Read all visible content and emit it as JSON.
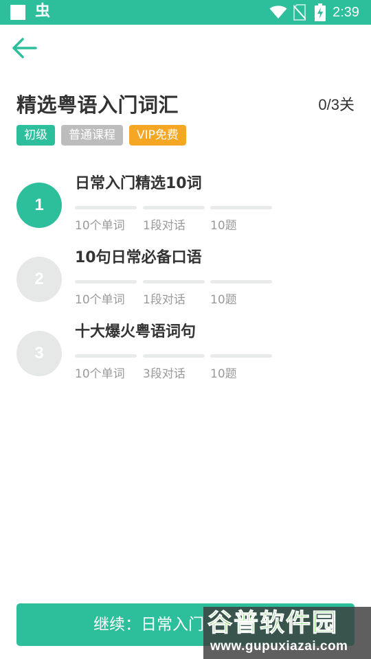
{
  "status_bar": {
    "app_icon": "虫",
    "time": "2:39",
    "icons": [
      "notification-square-icon",
      "wifi-icon",
      "no-sim-icon",
      "battery-charging-icon"
    ]
  },
  "back_icon": "arrow-left-icon",
  "course": {
    "title": "精选粤语入门词汇",
    "progress": "0/3关",
    "tags": {
      "level": "初级",
      "course_type": "普通课程",
      "vip": "VIP免费"
    }
  },
  "lessons": [
    {
      "number": "1",
      "title": "日常入门精选10词",
      "words": "10个单词",
      "dialogues": "1段对话",
      "questions": "10题",
      "active": true
    },
    {
      "number": "2",
      "title": "10句日常必备口语",
      "words": "10个单词",
      "dialogues": "1段对话",
      "questions": "10题",
      "active": false
    },
    {
      "number": "3",
      "title": "十大爆火粤语词句",
      "words": "10个单词",
      "dialogues": "3段对话",
      "questions": "10题",
      "active": false
    }
  ],
  "continue_button": {
    "label": "继续：日常入门"
  },
  "watermark": {
    "logo": "谷普软件园",
    "url": "www.gupuxiazai.com"
  },
  "colors": {
    "accent": "#2dbf9c",
    "tag_gray": "#bdbdbd",
    "tag_vip": "#f5a623",
    "inactive_circle": "#e6e8e7"
  }
}
